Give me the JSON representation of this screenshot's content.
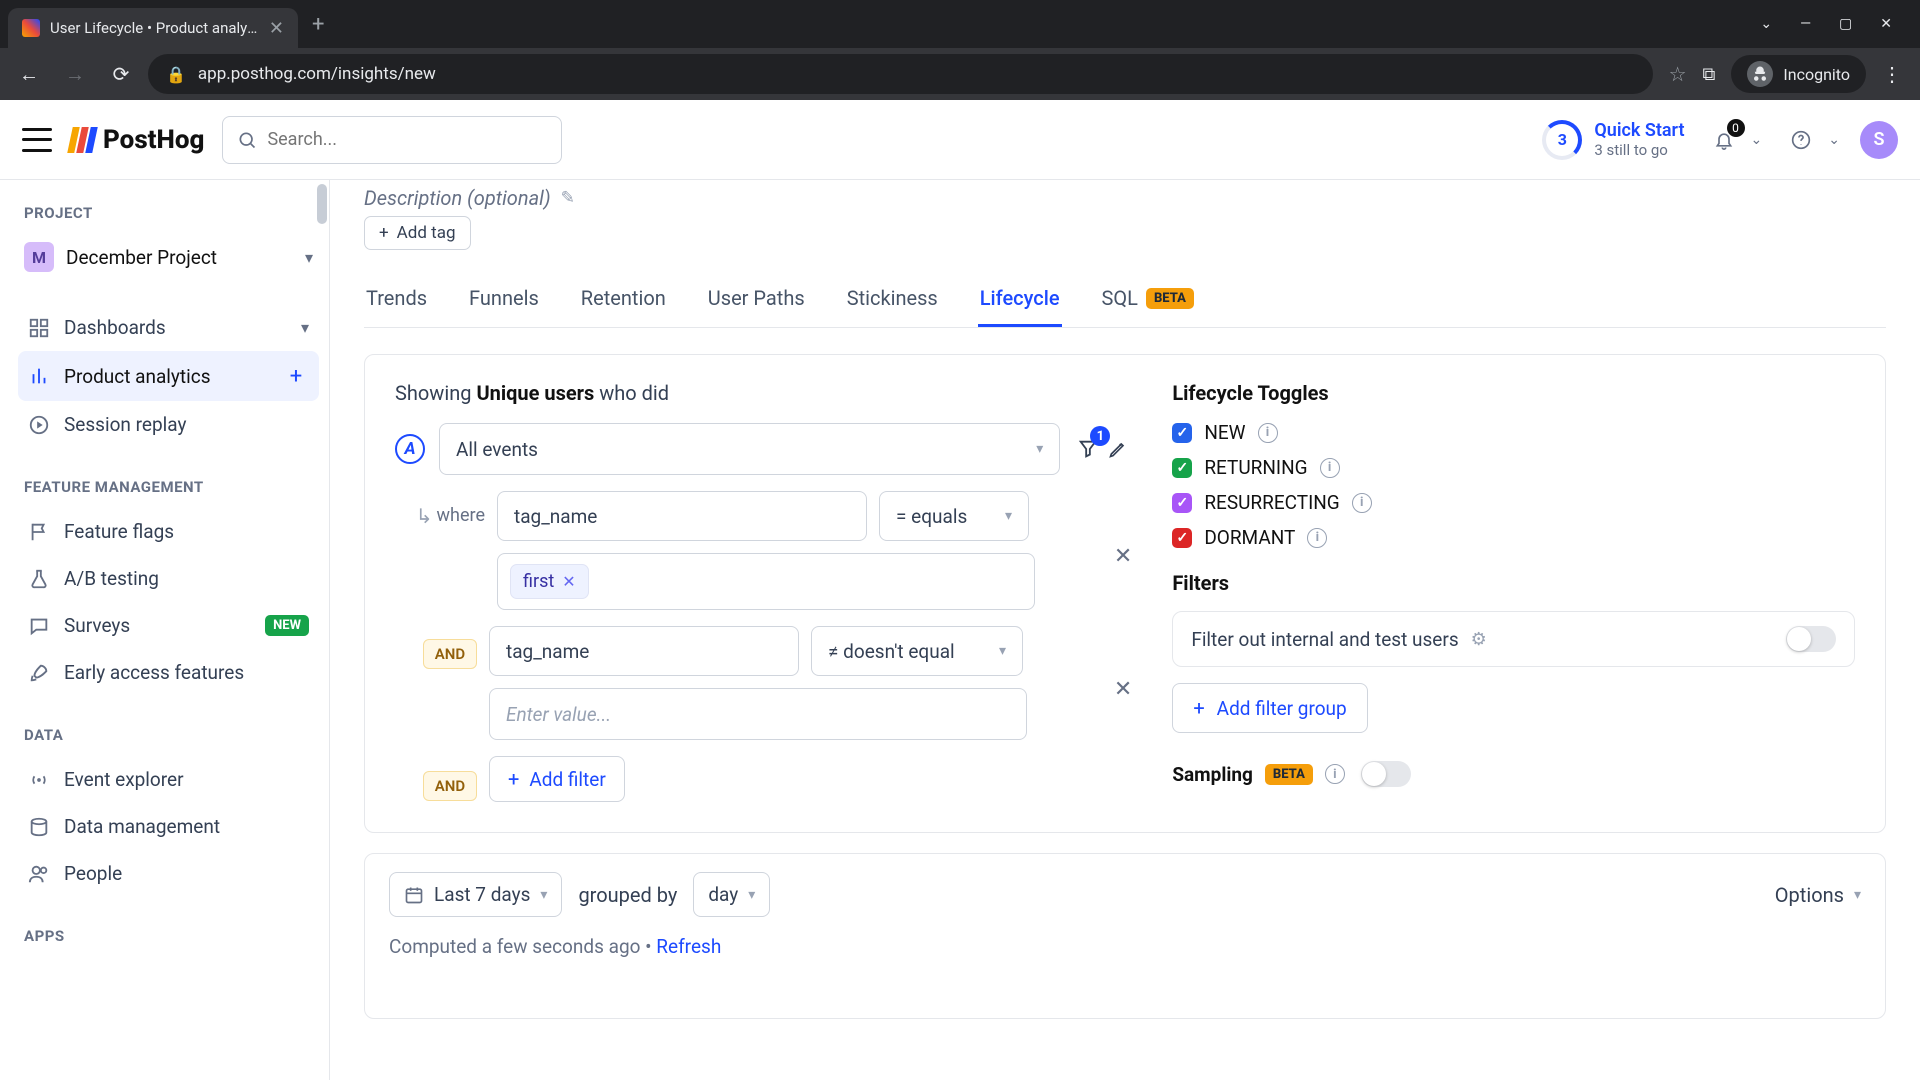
{
  "browser": {
    "tab_title": "User Lifecycle • Product analytics",
    "url": "app.posthog.com/insights/new",
    "incognito_label": "Incognito"
  },
  "header": {
    "search_placeholder": "Search...",
    "quick_start": {
      "count": "3",
      "title": "Quick Start",
      "subtitle": "3 still to go"
    },
    "notification_badge": "0",
    "avatar_initial": "S"
  },
  "sidebar": {
    "sections": {
      "project": "PROJECT",
      "feature": "FEATURE MANAGEMENT",
      "data": "DATA",
      "apps": "APPS"
    },
    "project": {
      "badge": "M",
      "name": "December Project"
    },
    "items": {
      "dashboards": "Dashboards",
      "product_analytics": "Product analytics",
      "session_replay": "Session replay",
      "feature_flags": "Feature flags",
      "ab_testing": "A/B testing",
      "surveys": "Surveys",
      "surveys_badge": "NEW",
      "early_access": "Early access features",
      "event_explorer": "Event explorer",
      "data_management": "Data management",
      "people": "People"
    }
  },
  "page": {
    "description_placeholder": "Description (optional)",
    "add_tag": "Add tag",
    "tabs": {
      "trends": "Trends",
      "funnels": "Funnels",
      "retention": "Retention",
      "user_paths": "User Paths",
      "stickiness": "Stickiness",
      "lifecycle": "Lifecycle",
      "sql": "SQL",
      "beta": "BETA"
    }
  },
  "query": {
    "showing_prefix": "Showing ",
    "showing_bold": "Unique users",
    "showing_suffix": " who did",
    "series_letter": "A",
    "event_name": "All events",
    "filter_badge_count": "1",
    "where_label": "where",
    "and_label": "AND",
    "filters": [
      {
        "property": "tag_name",
        "operator": "= equals",
        "value_chip": "first"
      },
      {
        "property": "tag_name",
        "operator": "≠ doesn't equal",
        "value_placeholder": "Enter value..."
      }
    ],
    "add_filter": "Add filter"
  },
  "toggles": {
    "heading": "Lifecycle Toggles",
    "new": "NEW",
    "returning": "RETURNING",
    "resurrecting": "RESURRECTING",
    "dormant": "DORMANT"
  },
  "filters_section": {
    "heading": "Filters",
    "filter_out_label": "Filter out internal and test users",
    "add_filter_group": "Add filter group"
  },
  "sampling": {
    "label": "Sampling",
    "beta": "BETA"
  },
  "bottom": {
    "date_range": "Last 7 days",
    "grouped_by": "grouped by",
    "interval": "day",
    "options": "Options",
    "computed": "Computed a few seconds ago • ",
    "refresh": "Refresh"
  }
}
